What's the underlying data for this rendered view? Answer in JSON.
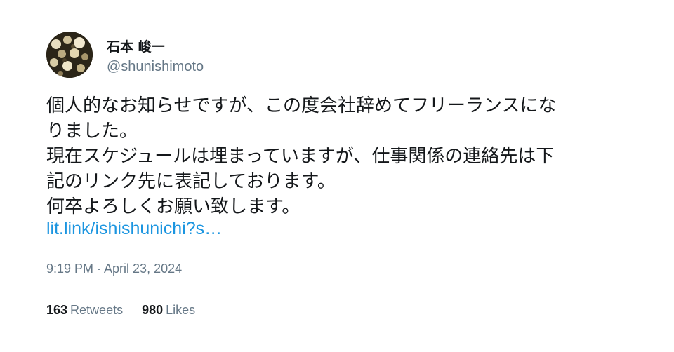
{
  "author": {
    "display_name": "石本 峻一",
    "handle": "@shunishimoto",
    "avatar_icon": "profile-avatar"
  },
  "tweet": {
    "lines": [
      "個人的なお知らせですが、この度会社辞めてフリーランスにな",
      "りました。",
      "現在スケジュールは埋まっていますが、仕事関係の連絡先は下",
      "記のリンク先に表記しております。",
      "何卒よろしくお願い致します。"
    ],
    "link_text": "lit.link/ishishunichi?s…",
    "timestamp": "9:19 PM · April 23, 2024"
  },
  "stats": {
    "retweets_count": "163",
    "retweets_label": "Retweets",
    "likes_count": "980",
    "likes_label": "Likes"
  },
  "colors": {
    "text": "#14171a",
    "secondary": "#657786",
    "link": "#1b95e0"
  }
}
